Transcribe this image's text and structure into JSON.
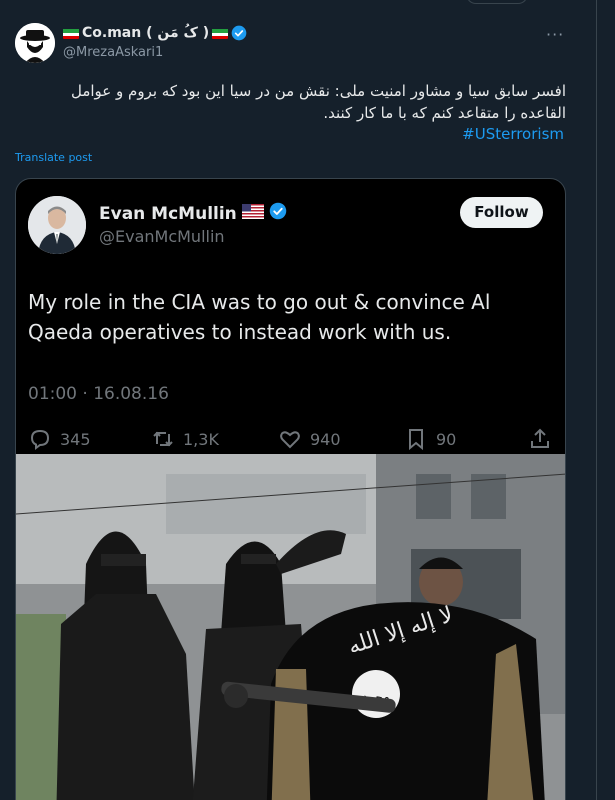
{
  "tweet": {
    "display_name": "Co.man ( کُ مَن )",
    "handle": "@MrezaAskari1",
    "text": "افسر سابق سیا و مشاور امنیت ملی: نقش من در سیا این بود که بروم و عوامل القاعده را متقاعد کنم که با ما کار کنند.",
    "hashtag": "#USterrorism",
    "translate_label": "Translate post",
    "more_label": "···"
  },
  "embedded": {
    "display_name": "Evan McMullin",
    "handle": "@EvanMcMullin",
    "follow_label": "Follow",
    "text": "My role in the CIA was to go out & convince Al Qaeda operatives to instead work with us.",
    "timestamp": "01:00 · 16.08.16",
    "stats": {
      "replies": "345",
      "retweets": "1,3K",
      "likes": "940",
      "bookmarks": "90"
    }
  },
  "colors": {
    "background": "#15202b",
    "accent": "#1d9bf0",
    "secondary_text": "#8b98a5",
    "card_background": "#000000"
  },
  "icons": [
    "hat-avatar-icon",
    "iran-flag-icon",
    "verified-badge-icon",
    "more-icon",
    "reply-icon",
    "retweet-icon",
    "like-icon",
    "bookmark-icon",
    "share-icon"
  ]
}
